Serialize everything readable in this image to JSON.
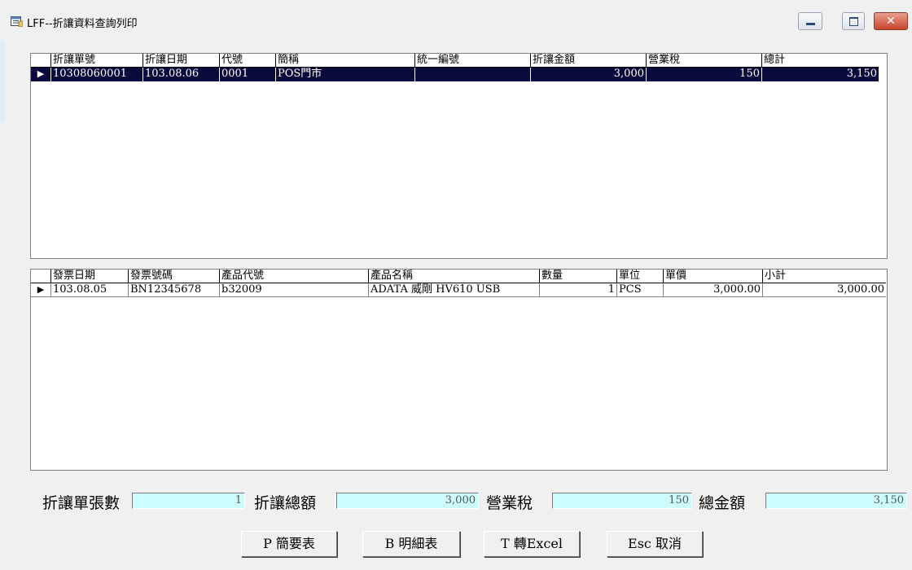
{
  "window": {
    "title": "LFF--折讓資料查詢列印",
    "close_glyph": "✕"
  },
  "master_grid": {
    "headers": [
      "",
      "折讓單號",
      "折讓日期",
      "代號",
      "簡稱",
      "統一編號",
      "折讓金額",
      "營業稅",
      "總計"
    ],
    "rows": [
      [
        "▶",
        "10308060001",
        "103.08.06",
        "0001",
        "POS門市",
        "",
        "3,000",
        "150",
        "3,150"
      ]
    ]
  },
  "detail_grid": {
    "headers": [
      "",
      "發票日期",
      "發票號碼",
      "產品代號",
      "產品名稱",
      "數量",
      "單位",
      "單價",
      "小計"
    ],
    "rows": [
      [
        "▶",
        "103.08.05",
        "BN12345678",
        "b32009",
        "ADATA 威剛 HV610 USB",
        "1",
        "PCS",
        "3,000.00",
        "3,000.00"
      ]
    ]
  },
  "summary": {
    "count_label": "折讓單張數",
    "count_value": "1",
    "total_label": "折讓總額",
    "total_value": "3,000",
    "tax_label": "營業稅",
    "tax_value": "150",
    "grand_label": "總金額",
    "grand_value": "3,150"
  },
  "buttons": {
    "summary": "P 簡要表",
    "detail": "B 明細表",
    "excel": "T 轉Excel",
    "cancel": "Esc 取消"
  },
  "colors": {
    "selected_row": "#0a0a3c",
    "summary_field": "#ccfcfc",
    "window_bg": "#f0f0f0"
  }
}
